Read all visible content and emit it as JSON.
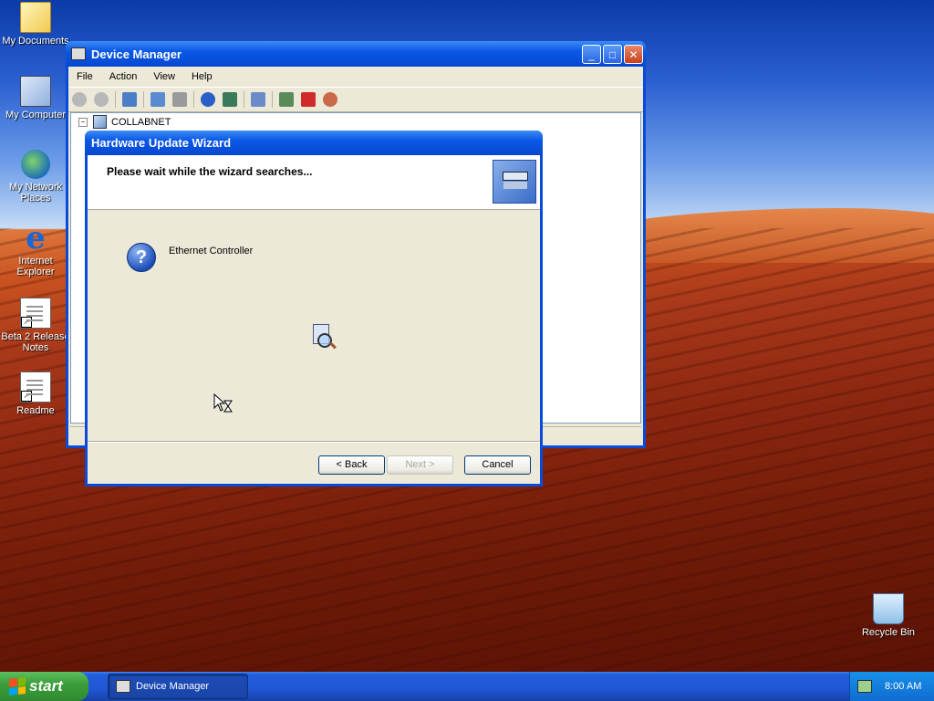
{
  "desktop": {
    "icons": [
      {
        "label": "My Documents",
        "icon": "my-documents-icon"
      },
      {
        "label": "My Computer",
        "icon": "my-computer-icon"
      },
      {
        "label": "My Network Places",
        "icon": "network-places-icon"
      },
      {
        "label": "Internet Explorer",
        "icon": "internet-explorer-icon"
      },
      {
        "label": "Beta 2 Release Notes",
        "icon": "release-notes-icon"
      },
      {
        "label": "Readme",
        "icon": "readme-icon"
      },
      {
        "label": "Recycle Bin",
        "icon": "recycle-bin-icon"
      }
    ]
  },
  "device_manager": {
    "title": "Device Manager",
    "menu": [
      "File",
      "Action",
      "View",
      "Help"
    ],
    "tree_root": "COLLABNET"
  },
  "wizard": {
    "title": "Hardware Update Wizard",
    "heading": "Please wait while the wizard searches...",
    "device": "Ethernet Controller",
    "buttons": {
      "back": "< Back",
      "next": "Next >",
      "cancel": "Cancel"
    }
  },
  "taskbar": {
    "start_label": "start",
    "task_label": "Device Manager",
    "clock": "8:00 AM"
  }
}
